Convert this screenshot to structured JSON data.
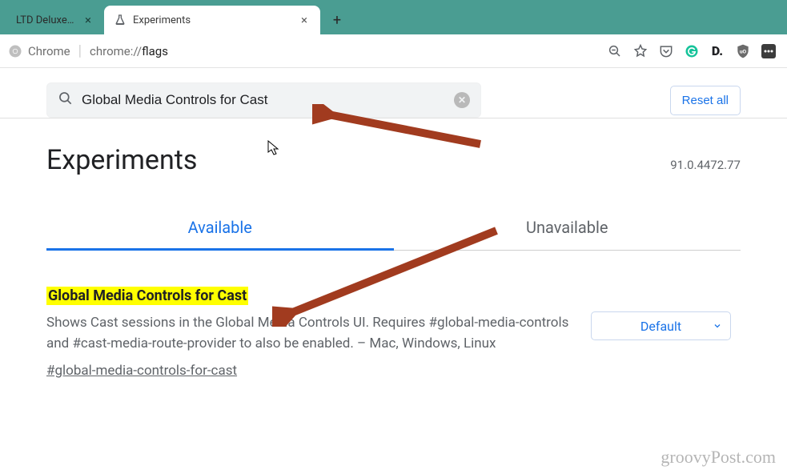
{
  "tabs_strip": {
    "inactive_title": "LTD Deluxe EC",
    "active_title": "Experiments"
  },
  "toolbar": {
    "label": "Chrome",
    "url_scheme": "chrome://",
    "url_path": "flags"
  },
  "search": {
    "value": "Global Media Controls for Cast"
  },
  "reset_label": "Reset all",
  "page_title": "Experiments",
  "version": "91.0.4472.77",
  "flag_tabs": {
    "available": "Available",
    "unavailable": "Unavailable"
  },
  "flag": {
    "title": "Global Media Controls for Cast",
    "description": "Shows Cast sessions in the Global Media Controls UI. Requires #global-media-controls and #cast-media-route-provider to also be enabled. – Mac, Windows, Linux",
    "anchor": "#global-media-controls-for-cast",
    "selected": "Default"
  },
  "watermark": "groovyPost.com"
}
